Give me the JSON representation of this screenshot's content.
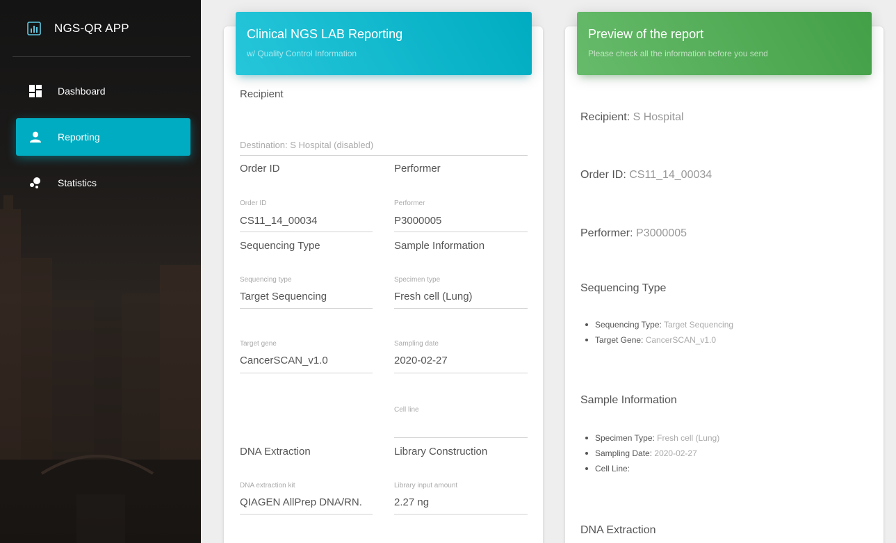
{
  "app": {
    "name": "NGS-QR APP"
  },
  "sidebar": {
    "items": [
      {
        "label": "Dashboard",
        "icon": "dashboard-icon",
        "active": false
      },
      {
        "label": "Reporting",
        "icon": "person-icon",
        "active": true
      },
      {
        "label": "Statistics",
        "icon": "bubble-chart-icon",
        "active": false
      }
    ]
  },
  "form_card": {
    "title": "Clinical NGS LAB Reporting",
    "subtitle": "w/ Quality Control Information",
    "recipient_heading": "Recipient",
    "destination_text": "Destination: S Hospital (disabled)",
    "order_heading": "Order ID",
    "performer_heading": "Performer",
    "order_label": "Order ID",
    "order_value": "CS11_14_00034",
    "performer_label": "Performer",
    "performer_value": "P3000005",
    "seq_heading": "Sequencing Type",
    "sample_heading": "Sample Information",
    "seq_type_label": "Sequencing type",
    "seq_type_value": "Target Sequencing",
    "specimen_label": "Specimen type",
    "specimen_value": "Fresh cell (Lung)",
    "target_gene_label": "Target gene",
    "target_gene_value": "CancerSCAN_v1.0",
    "sampling_date_label": "Sampling date",
    "sampling_date_value": "2020-02-27",
    "cell_line_label": "Cell line",
    "cell_line_value": "",
    "dna_heading": "DNA Extraction",
    "library_heading": "Library Construction",
    "dna_kit_label": "DNA extraction kit",
    "dna_kit_value": "QIAGEN AllPrep DNA/RN.",
    "library_input_label": "Library input amount",
    "library_input_value": "2.27 ng"
  },
  "preview_card": {
    "title": "Preview of the report",
    "subtitle": "Please check all the information before you send",
    "recipient_label": "Recipient:",
    "recipient_value": "S Hospital",
    "order_label": "Order ID:",
    "order_value": "CS11_14_00034",
    "performer_label": "Performer:",
    "performer_value": "P3000005",
    "seq_heading": "Sequencing Type",
    "seq_items": [
      {
        "label": "Sequencing Type:",
        "value": "Target Sequencing"
      },
      {
        "label": "Target Gene:",
        "value": "CancerSCAN_v1.0"
      }
    ],
    "sample_heading": "Sample Information",
    "sample_items": [
      {
        "label": "Specimen Type:",
        "value": "Fresh cell (Lung)"
      },
      {
        "label": "Sampling Date:",
        "value": "2020-02-27"
      },
      {
        "label": "Cell Line:",
        "value": ""
      }
    ],
    "dna_heading": "DNA Extraction"
  },
  "colors": {
    "active_nav": "#00acc1",
    "form_header": "#00acc1",
    "preview_header": "#4caf50"
  }
}
